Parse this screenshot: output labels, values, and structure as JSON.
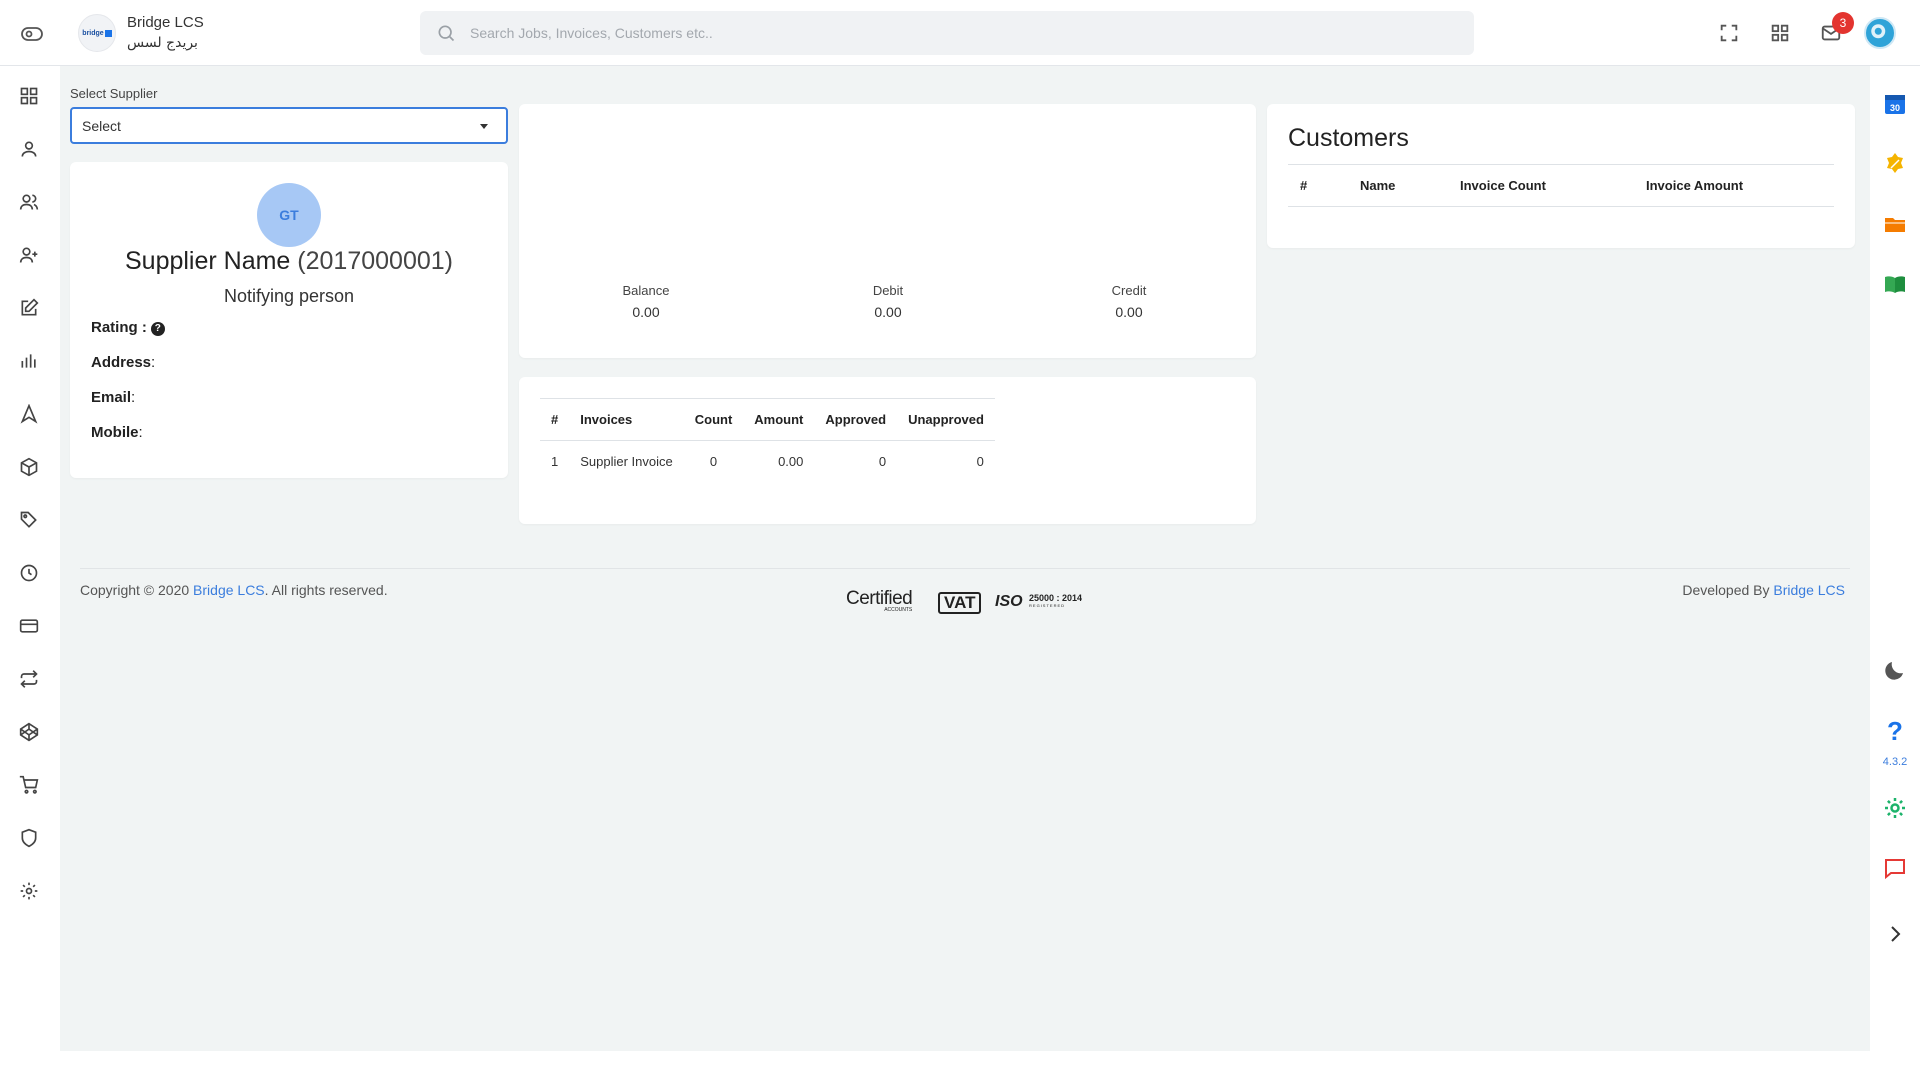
{
  "header": {
    "brand_name": "Bridge LCS",
    "brand_sub": "بريدج لسس",
    "logo_text": "bridge",
    "search_placeholder": "Search Jobs, Invoices, Customers etc..",
    "notification_count": "3"
  },
  "sidebar": {
    "items": [
      "dashboard-icon",
      "user-icon",
      "users-icon",
      "user-plus-icon",
      "edit-icon",
      "bar-chart-icon",
      "navigation-icon",
      "box-icon",
      "tag-icon",
      "clock-icon",
      "credit-card-icon",
      "repeat-icon",
      "codepen-icon",
      "shopping-cart-icon",
      "shield-icon",
      "settings-icon"
    ]
  },
  "rightbar": {
    "calendar_day": "30",
    "version": "4.3.2"
  },
  "supplier": {
    "select_label": "Select Supplier",
    "select_value": "Select",
    "avatar_initials": "GT",
    "name": "Supplier Name",
    "code": "(2017000001)",
    "notifying": "Notifying person",
    "rating_label": "Rating :",
    "address_label": "Address",
    "email_label": "Email",
    "mobile_label": "Mobile"
  },
  "summary": {
    "balance_label": "Balance",
    "balance_value": "0.00",
    "debit_label": "Debit",
    "debit_value": "0.00",
    "credit_label": "Credit",
    "credit_value": "0.00"
  },
  "invoices": {
    "headers": [
      "#",
      "Invoices",
      "Count",
      "Amount",
      "Approved",
      "Unapproved"
    ],
    "rows": [
      [
        "1",
        "Supplier Invoice",
        "0",
        "0.00",
        "0",
        "0"
      ]
    ]
  },
  "customers": {
    "title": "Customers",
    "headers": [
      "#",
      "Name",
      "Invoice Count",
      "Invoice Amount"
    ]
  },
  "footer": {
    "copyright_prefix": "Copyright © 2020",
    "copyright_link": "Bridge LCS",
    "copyright_suffix": ". All rights reserved.",
    "developed_prefix": "Developed By",
    "developed_link": "Bridge LCS",
    "cert_certified": "Certified",
    "cert_accounts": "ACCOUNTS",
    "cert_vat": "VAT",
    "cert_iso": "ISO",
    "cert_iso_num": "25000 : 2014",
    "cert_registered": "REGISTERED"
  },
  "colors": {
    "accent": "#3b7ddd",
    "badge": "#e3342f",
    "background": "#f1f4f4"
  }
}
